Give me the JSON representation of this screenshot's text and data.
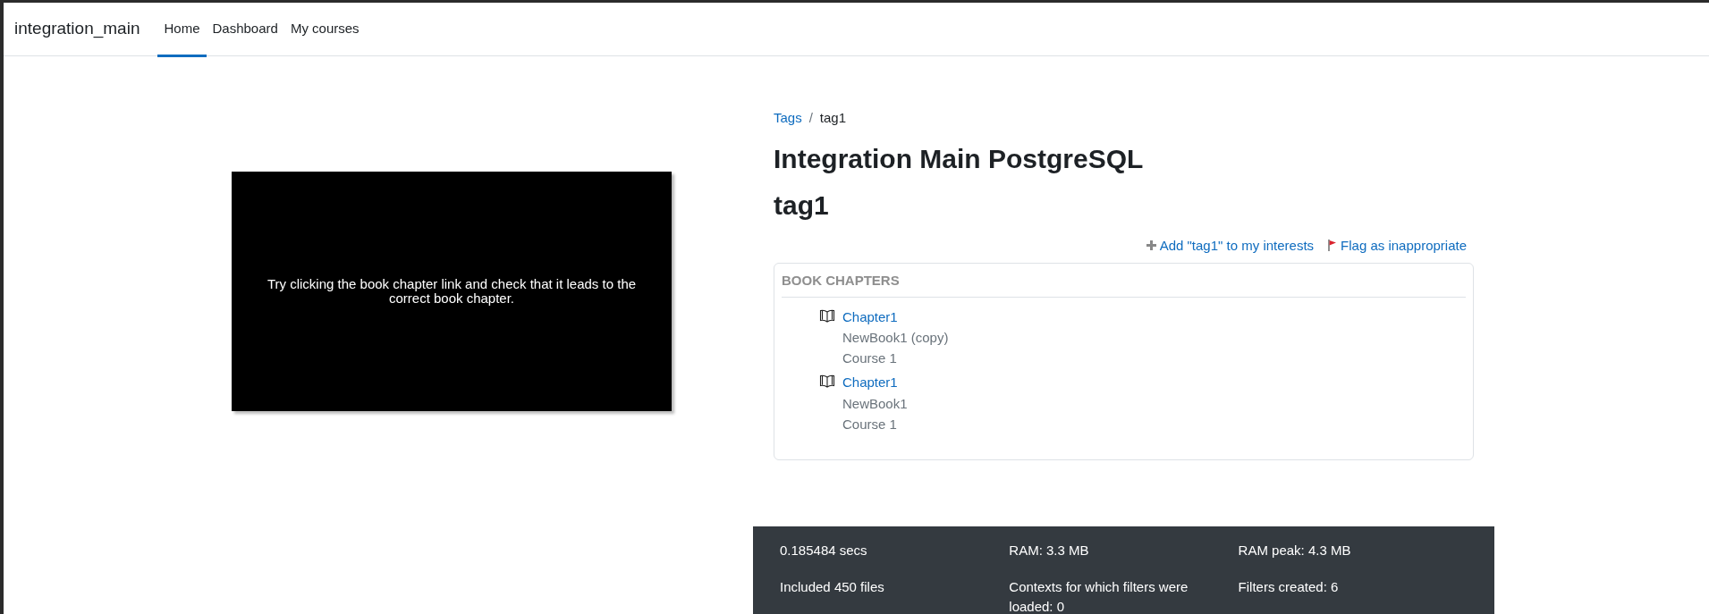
{
  "navbar": {
    "brand": "integration_main",
    "items": [
      {
        "label": "Home",
        "selected": true
      },
      {
        "label": "Dashboard",
        "selected": false
      },
      {
        "label": "My courses",
        "selected": false
      }
    ]
  },
  "note": {
    "text": "Try clicking the book chapter link and check that it leads to the correct book chapter."
  },
  "breadcrumb": [
    {
      "label": "Tags",
      "kind": "link"
    },
    {
      "label": "/",
      "kind": "separator"
    },
    {
      "label": "tag1",
      "kind": "current"
    }
  ],
  "site_title": "Integration Main PostgreSQL",
  "tag_title": "tag1",
  "actions": [
    {
      "label": "Add \"tag1\" to my interests",
      "kind": "add"
    },
    {
      "label": "Flag as inappropriate",
      "kind": "flag"
    }
  ],
  "card": {
    "title": "BOOK CHAPTERS",
    "items": [
      {
        "title": "Chapter1",
        "book": "NewBook1 (copy)",
        "course": "Course 1"
      },
      {
        "title": "Chapter1",
        "book": "NewBook1",
        "course": "Course 1"
      }
    ]
  },
  "footer": {
    "stats": [
      "0.185484 secs",
      "RAM: 3.3 MB",
      "RAM peak: 4.3 MB",
      "Included 450 files",
      "Contexts for which filters were loaded: 0",
      "Filters created: 6"
    ]
  }
}
